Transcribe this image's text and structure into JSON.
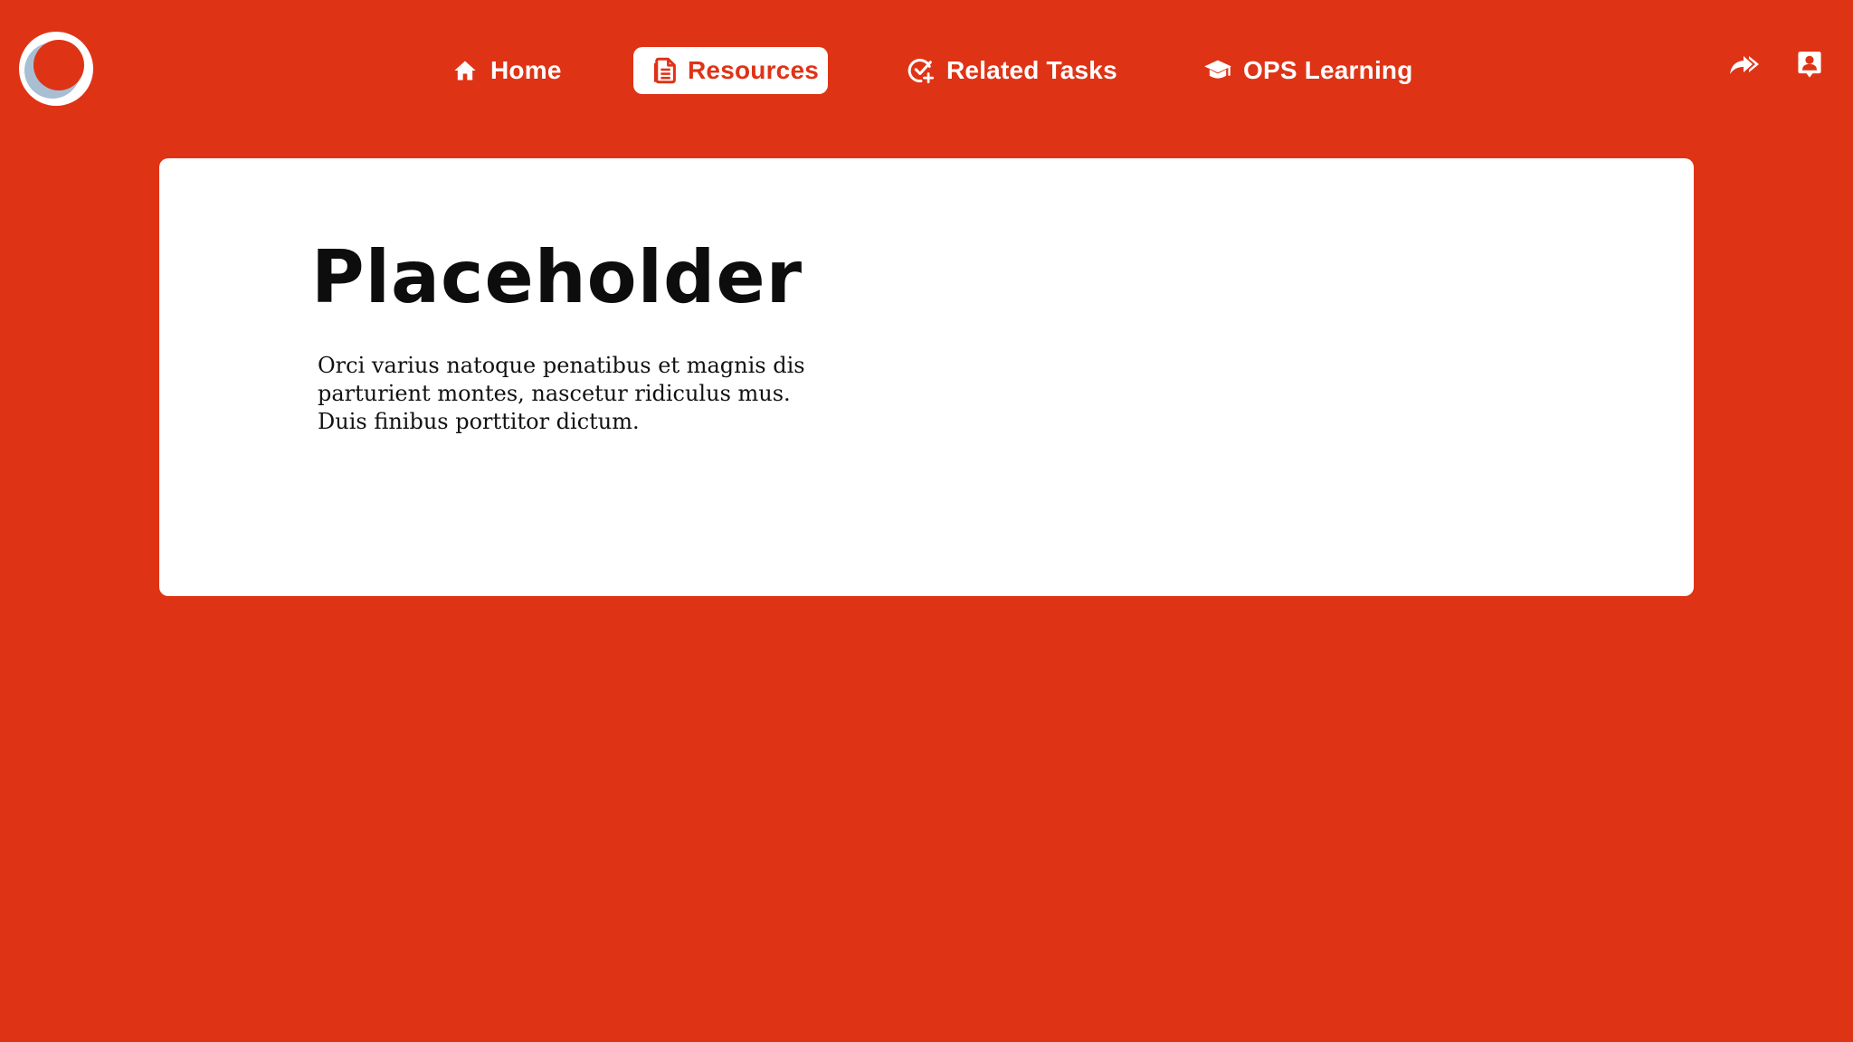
{
  "colors": {
    "background": "#DF3316",
    "card": "#FFFFFF",
    "nav_active_bg": "#FFFFFF",
    "nav_active_text": "#DF3316",
    "nav_text": "#FFFFFF",
    "logo_ring": "#FFFFFF",
    "logo_accent": "#A8BFD3"
  },
  "header": {
    "logo_icon": "circle-logo-icon",
    "nav": [
      {
        "label": "Home",
        "icon": "home-icon",
        "active": false
      },
      {
        "label": "Resources",
        "icon": "document-icon",
        "active": true
      },
      {
        "label": "Related Tasks",
        "icon": "check-plus-icon",
        "active": false
      },
      {
        "label": "OPS Learning",
        "icon": "graduation-cap-icon",
        "active": false
      }
    ],
    "actions": [
      {
        "icon": "share-forward-icon"
      },
      {
        "icon": "profile-badge-icon"
      }
    ]
  },
  "card": {
    "title": "Placeholder",
    "body_lines": [
      "Orci varius natoque penatibus et magnis dis",
      "parturient montes, nascetur ridiculus mus.",
      "Duis finibus porttitor dictum."
    ]
  }
}
